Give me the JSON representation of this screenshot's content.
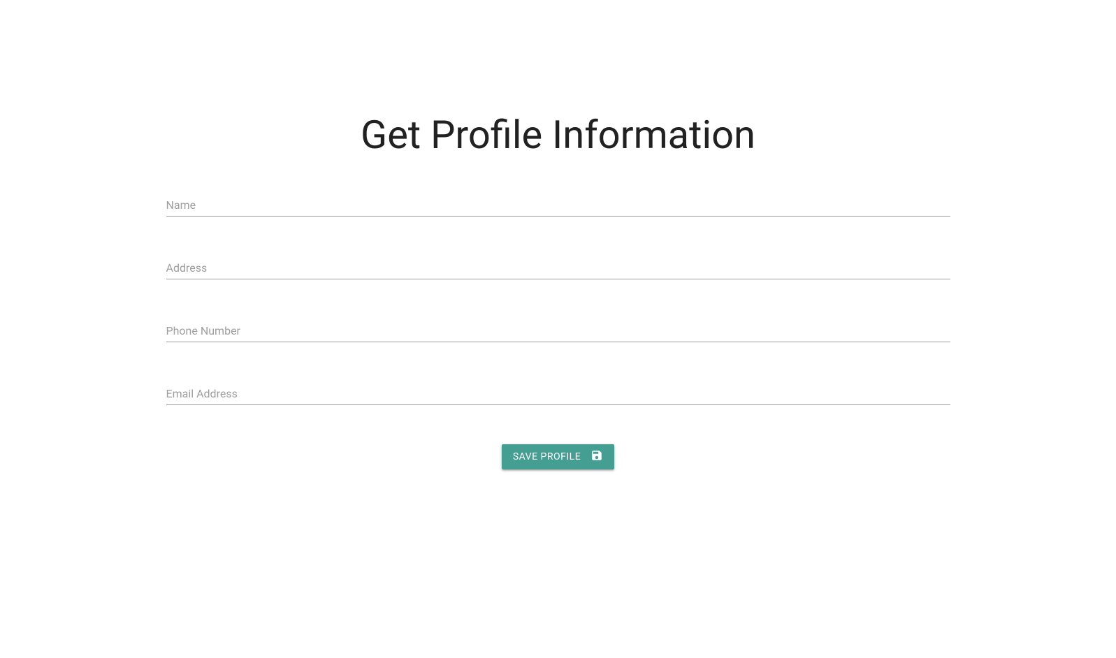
{
  "page": {
    "title": "Get Profile Information"
  },
  "form": {
    "fields": {
      "name": {
        "placeholder": "Name",
        "value": ""
      },
      "address": {
        "placeholder": "Address",
        "value": ""
      },
      "phone": {
        "placeholder": "Phone Number",
        "value": ""
      },
      "email": {
        "placeholder": "Email Address",
        "value": ""
      }
    },
    "submit": {
      "label": "SAVE PROFILE"
    }
  }
}
